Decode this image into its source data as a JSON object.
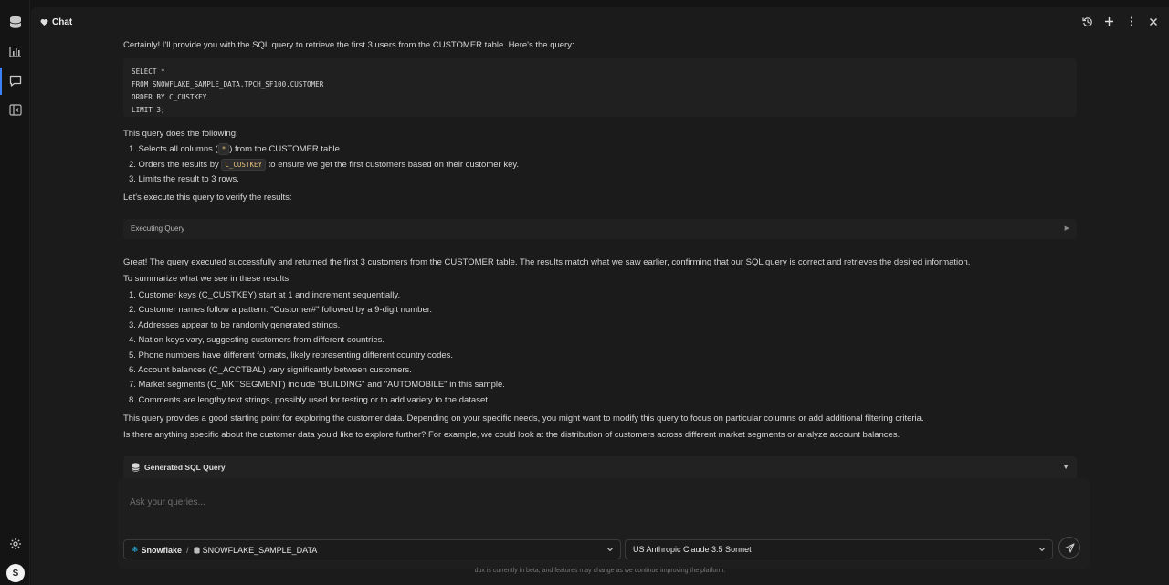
{
  "header": {
    "title": "Chat"
  },
  "message": {
    "intro": "Certainly! I'll provide you with the SQL query to retrieve the first 3 users from the CUSTOMER table. Here's the query:",
    "code_lines": [
      "SELECT *",
      "FROM SNOWFLAKE_SAMPLE_DATA.TPCH_SF100.CUSTOMER",
      "ORDER BY C_CUSTKEY",
      "LIMIT 3;"
    ],
    "does_heading": "This query does the following:",
    "steps": [
      {
        "pre": "1. Selects all columns (",
        "code": "*",
        "post": ") from the CUSTOMER table."
      },
      {
        "pre": "2. Orders the results by ",
        "code": "C_CUSTKEY",
        "post": " to ensure we get the first customers based on their customer key."
      },
      {
        "pre": "3. Limits the result to 3 rows.",
        "code": "",
        "post": ""
      }
    ],
    "execute_text": "Let's execute this query to verify the results:",
    "executing_label": "Executing Query",
    "great": "Great! The query executed successfully and returned the first 3 customers from the CUSTOMER table. The results match what we saw earlier, confirming that our SQL query is correct and retrieves the desired information.",
    "summary_heading": "To summarize what we see in these results:",
    "summary": [
      "1. Customer keys (C_CUSTKEY) start at 1 and increment sequentially.",
      "2. Customer names follow a pattern: \"Customer#\" followed by a 9-digit number.",
      "3. Addresses appear to be randomly generated strings.",
      "4. Nation keys vary, suggesting customers from different countries.",
      "5. Phone numbers have different formats, likely representing different country codes.",
      "6. Account balances (C_ACCTBAL) vary significantly between customers.",
      "7. Market segments (C_MKTSEGMENT) include \"BUILDING\" and \"AUTOMOBILE\" in this sample.",
      "8. Comments are lengthy text strings, possibly used for testing or to add variety to the dataset."
    ],
    "closing1": "This query provides a good starting point for exploring the customer data. Depending on your specific needs, you might want to modify this query to focus on particular columns or add additional filtering criteria.",
    "closing2": "Is there anything specific about the customer data you'd like to explore further? For example, we could look at the distribution of customers across different market segments or analyze account balances."
  },
  "generated_sql_label": "Generated SQL Query",
  "input": {
    "placeholder": "Ask your queries..."
  },
  "datasource": {
    "connector": "Snowflake",
    "separator": "/",
    "database": "SNOWFLAKE_SAMPLE_DATA"
  },
  "model": {
    "label": "US Anthropic Claude 3.5 Sonnet"
  },
  "footer": "dbx is currently in beta, and features may change as we continue improving the platform.",
  "user": {
    "initial": "S"
  },
  "colors": {
    "accent": "#3b82f6",
    "inline_code": "#e6c07b",
    "snowflake": "#29b5e8"
  }
}
